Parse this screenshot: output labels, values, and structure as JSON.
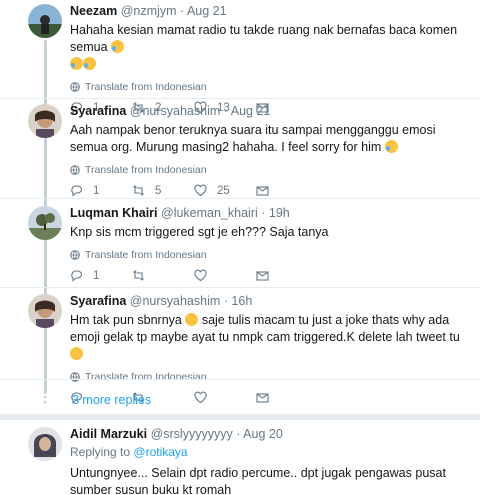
{
  "tweets": [
    {
      "name": "Neezam",
      "handle": "@nzmjym",
      "sep": "·",
      "time": "Aug 21",
      "text": "Hahaha kesian mamat radio tu takde ruang nak bernafas baca komen semua",
      "translate": "Translate from Indonesian",
      "replies": "1",
      "retweets": "2",
      "likes": "13"
    },
    {
      "name": "Syarafina",
      "handle": "@nursyahashim",
      "sep": "·",
      "time": "Aug 21",
      "text": "Aah nampak benor teruknya suara itu sampai mengganggu emosi semua org. Murung masing2 hahaha. I feel sorry for him",
      "translate": "Translate from Indonesian",
      "replies": "1",
      "retweets": "5",
      "likes": "25"
    },
    {
      "name": "Luqman Khairi",
      "handle": "@lukeman_khairi",
      "sep": "·",
      "time": "19h",
      "text": "Knp sis mcm triggered sgt je eh??? Saja tanya",
      "translate": "Translate from Indonesian",
      "replies": "1",
      "retweets": "",
      "likes": ""
    },
    {
      "name": "Syarafina",
      "handle": "@nursyahashim",
      "sep": "·",
      "time": "16h",
      "text_a": "Hm tak pun sbnrnya",
      "text_b": "saje tulis macam tu just a joke thats why ada emoji gelak tp maybe ayat tu nmpk cam triggered.K delete lah tweet tu",
      "translate": "Translate from Indonesian",
      "replies": "",
      "retweets": "",
      "likes": ""
    },
    {
      "name": "Aidil Marzuki",
      "handle": "@srslyyyyyyyy",
      "sep": "·",
      "time": "Aug 20",
      "reply_prefix": "Replying to",
      "reply_target": "@rotikaya",
      "text": "Untungnyee... Selain dpt radio percume.. dpt jugak pengawas pusat sumber susun buku kt romah"
    }
  ],
  "more_replies": "3 more replies",
  "colors": {
    "accent": "#1da1f2",
    "muted": "#657786",
    "thread_line": "#c4cfd6"
  }
}
